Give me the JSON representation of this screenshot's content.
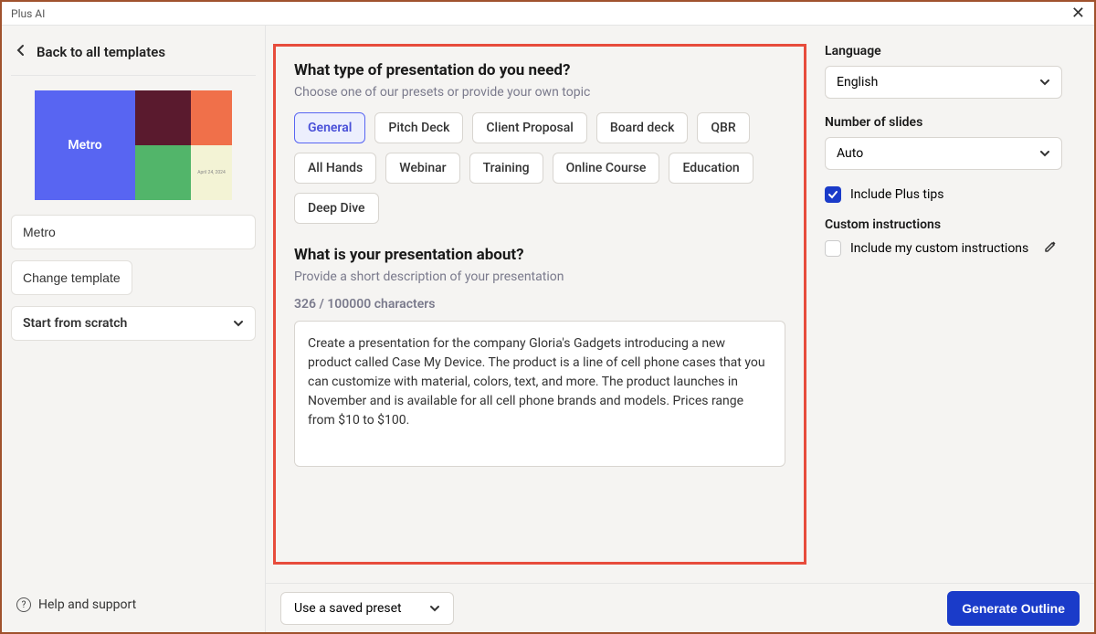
{
  "app_title": "Plus AI",
  "sidebar": {
    "back_label": "Back to all templates",
    "template_preview_name": "Metro",
    "template_name_value": "Metro",
    "change_template_label": "Change template",
    "start_scratch_label": "Start from scratch",
    "preview_date": "April 24, 2024",
    "help_label": "Help and support"
  },
  "main": {
    "type_title": "What type of presentation do you need?",
    "type_sub": "Choose one of our presets or provide your own topic",
    "presets": [
      "General",
      "Pitch Deck",
      "Client Proposal",
      "Board deck",
      "QBR",
      "All Hands",
      "Webinar",
      "Training",
      "Online Course",
      "Education",
      "Deep Dive"
    ],
    "about_title": "What is your presentation about?",
    "about_sub": "Provide a short description of your presentation",
    "char_count": "326 / 100000 characters",
    "description_value": "Create a presentation for the company Gloria's Gadgets introducing a new product called Case My Device. The product is a line of cell phone cases that you can customize with material, colors, text, and more. The product launches in November and is available for all cell phone brands and models. Prices range from $10 to $100."
  },
  "right": {
    "language_label": "Language",
    "language_value": "English",
    "slides_label": "Number of slides",
    "slides_value": "Auto",
    "plus_tips_label": "Include Plus tips",
    "custom_label": "Custom instructions",
    "include_custom_label": "Include my custom instructions"
  },
  "footer": {
    "preset_label": "Use a saved preset",
    "generate_label": "Generate Outline"
  }
}
